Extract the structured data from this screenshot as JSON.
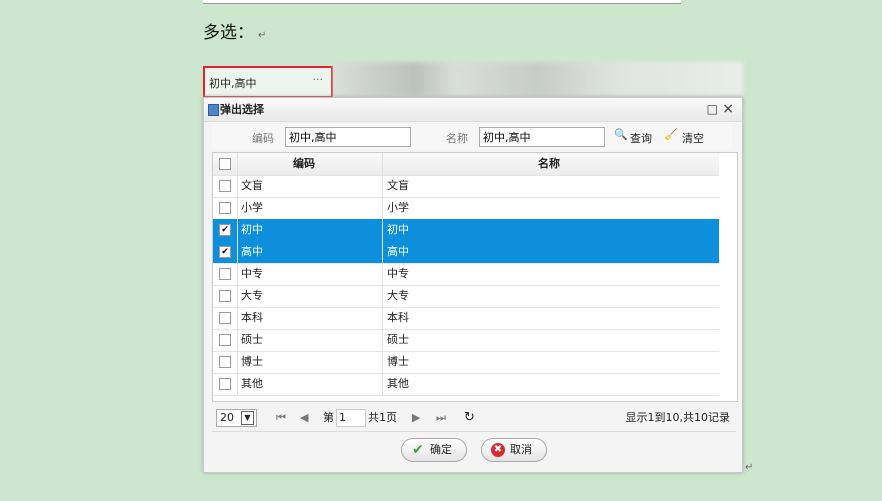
{
  "doc": {
    "label": "多选：",
    "return_mark": "↵",
    "end_mark": "↵"
  },
  "field": {
    "value": "初中,高中",
    "more": "···"
  },
  "dialog": {
    "title": "弹出选择",
    "max": "□",
    "close": "×",
    "search": {
      "code_label": "编码",
      "code_value": "初中,高中",
      "name_label": "名称",
      "name_value": "初中,高中",
      "query": "查询",
      "clear": "清空"
    },
    "columns": [
      "编码",
      "名称"
    ],
    "rows": [
      {
        "code": "文盲",
        "name": "文盲",
        "checked": false
      },
      {
        "code": "小学",
        "name": "小学",
        "checked": false
      },
      {
        "code": "初中",
        "name": "初中",
        "checked": true
      },
      {
        "code": "高中",
        "name": "高中",
        "checked": true
      },
      {
        "code": "中专",
        "name": "中专",
        "checked": false
      },
      {
        "code": "大专",
        "name": "大专",
        "checked": false
      },
      {
        "code": "本科",
        "name": "本科",
        "checked": false
      },
      {
        "code": "硕士",
        "name": "硕士",
        "checked": false
      },
      {
        "code": "博士",
        "name": "博士",
        "checked": false
      },
      {
        "code": "其他",
        "name": "其他",
        "checked": false
      }
    ],
    "pager": {
      "page_size": "20",
      "page_prefix": "第",
      "page": "1",
      "page_suffix": "共1页",
      "summary": "显示1到10,共10记录"
    },
    "ok": "确定",
    "cancel": "取消"
  },
  "colors": {
    "selected": "#0d8fdc",
    "highlight": "#e0252a"
  }
}
